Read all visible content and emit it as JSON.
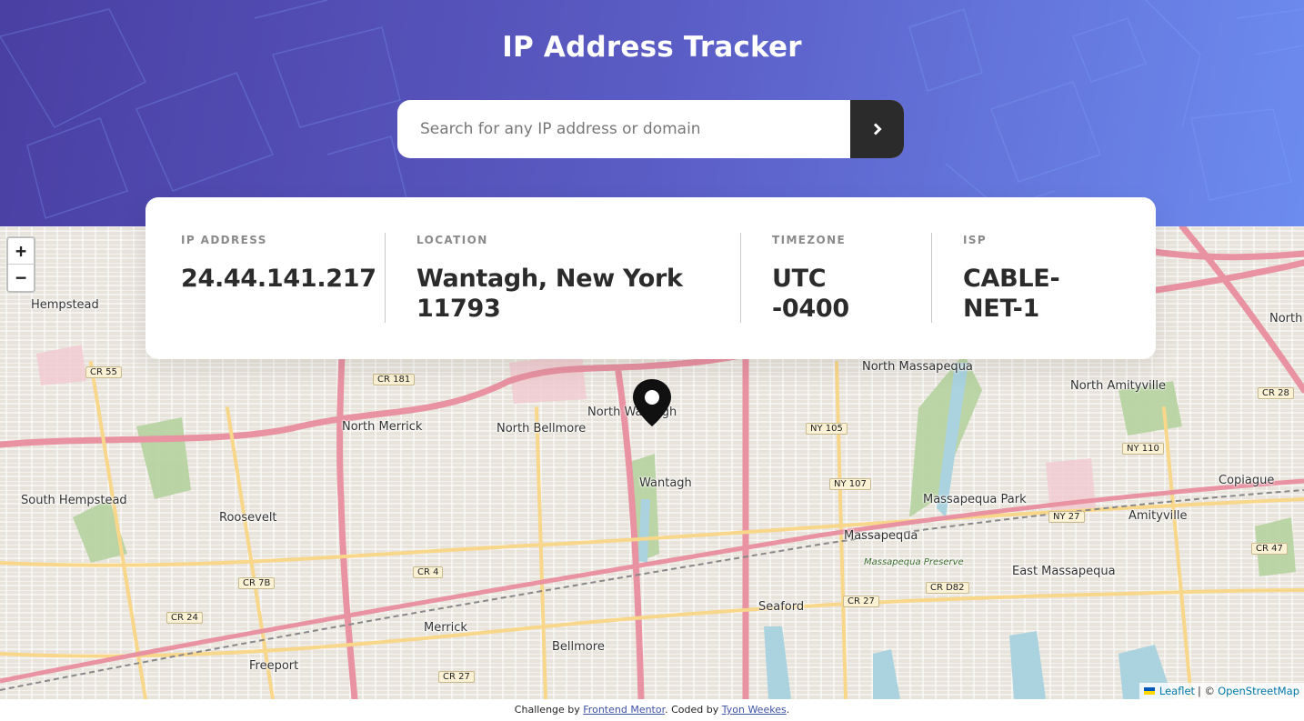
{
  "header": {
    "title": "IP Address Tracker",
    "search_placeholder": "Search for any IP address or domain",
    "search_value": ""
  },
  "info": {
    "ip": {
      "label": "IP ADDRESS",
      "value": "24.44.141.217"
    },
    "location": {
      "label": "LOCATION",
      "value": "Wantagh, New York 11793"
    },
    "timezone": {
      "label": "TIMEZONE",
      "value": "UTC -0400"
    },
    "isp": {
      "label": "ISP",
      "value": "CABLE-NET-1"
    }
  },
  "map": {
    "zoom_in": "+",
    "zoom_out": "−",
    "places": [
      "Hempstead",
      "North Merrick",
      "North Bellmore",
      "North Wantagh",
      "Wantagh",
      "North Massapequa",
      "North Amityville",
      "South Hempstead",
      "Roosevelt",
      "Massapequa Park",
      "Amityville",
      "Copiague",
      "Massapequa",
      "Massapequa Preserve",
      "East Massapequa",
      "Seaford",
      "Merrick",
      "Bellmore",
      "Freeport",
      "North"
    ],
    "shields": [
      "CR 55",
      "CR 181",
      "NY 105",
      "CR 28",
      "NY 110",
      "NY 107",
      "NY 27",
      "CR 47",
      "CR 4",
      "CR 7B",
      "CR 24",
      "CR 27",
      "CR D82",
      "CR 27"
    ],
    "attribution": {
      "leaflet": "Leaflet",
      "sep": " | © ",
      "osm": "OpenStreetMap"
    }
  },
  "footer": {
    "prefix": "Challenge by ",
    "link1": "Frontend Mentor",
    "middle": ". Coded by ",
    "link2": "Tyon Weekes",
    "suffix": "."
  },
  "colors": {
    "header_start": "#4a3fa3",
    "header_end": "#6d8cf0",
    "button": "#2b2b2b",
    "value_text": "#2b2b2b",
    "label_text": "#8a8a8a"
  }
}
